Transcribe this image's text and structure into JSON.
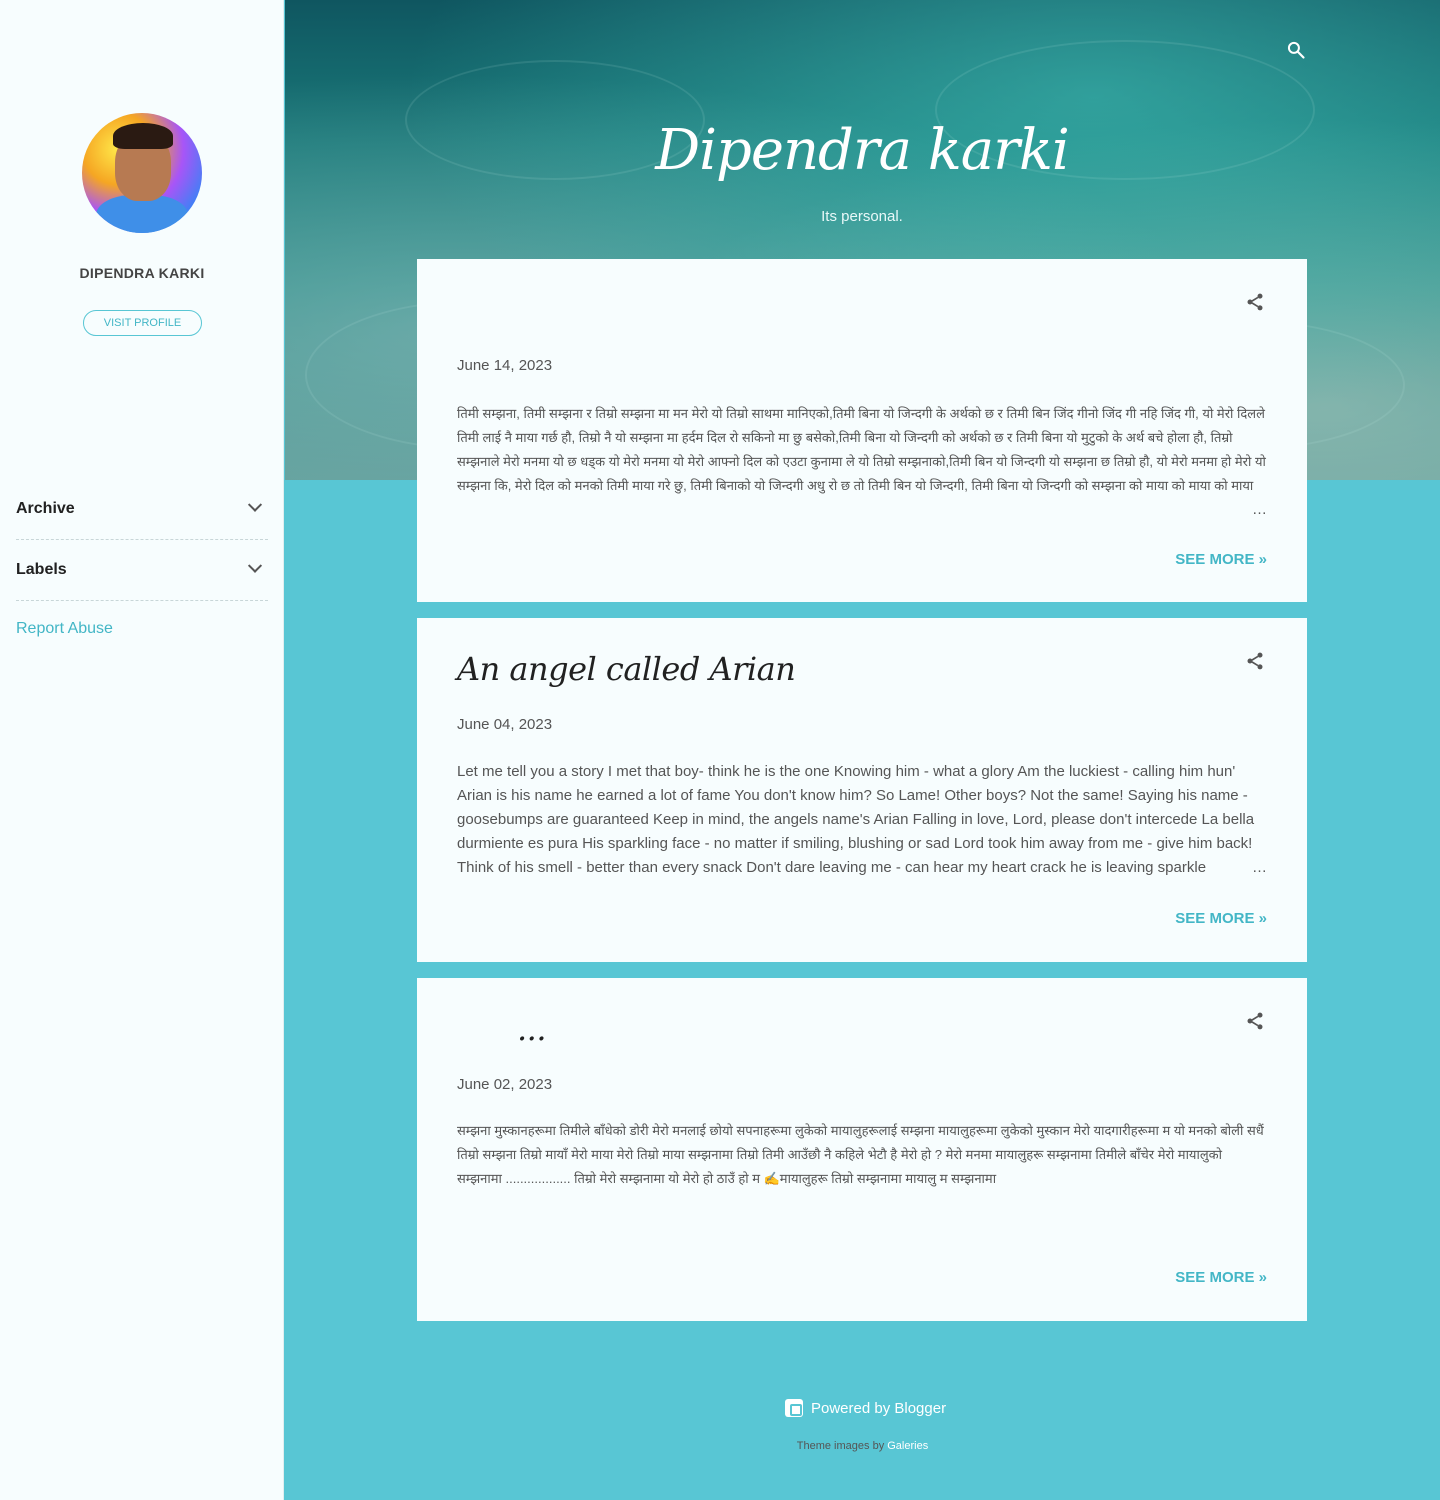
{
  "sidebar": {
    "profile_name": "DIPENDRA KARKI",
    "visit_profile_label": "VISIT PROFILE",
    "sections": [
      {
        "label": "Archive",
        "icon": "chevron-down-icon"
      },
      {
        "label": "Labels",
        "icon": "chevron-down-icon"
      }
    ],
    "report_abuse_label": "Report Abuse"
  },
  "header": {
    "title": "Dipendra karki",
    "description": "Its personal.",
    "search_icon": "search-icon"
  },
  "posts": [
    {
      "title": "",
      "date": "June 14, 2023",
      "snippet": "तिमी सम्झना, तिमी सम्झना र तिम्रो सम्झना मा मन मेरो यो तिम्रो साथमा मानिएको,तिमी बिना यो जिन्दगी के अर्थको छ र  तिमी बिन जिंद गीनो जिंद गी नहि जिंद गी, यो मेरो दिलले तिमी लाई नै माया गर्छ हौ, तिम्रो नै यो सम्झना मा हर्दम दिल रो सकिनो मा छु बसेको,तिमी बिना यो जिन्दगी को अर्थको छ र  तिमी बिना यो मुटुको के अर्थ बचे होला हौ, तिम्रो सम्झनाले मेरो मनमा यो छ धड्क यो मेरो मनमा यो मेरो आफ्नो दिल को एउटा कुनामा ले यो तिम्रो सम्झनाको,तिमी बिन यो जिन्दगी यो सम्झना छ तिम्रो हौ, यो मेरो मनमा हो मेरो यो सम्झना कि, मेरो दिल को मनको तिमी माया गरे छु, तिमी बिनाको यो जिन्दगी अधु रो छ तो तिमी बिन यो जिन्दगी, तिमी बिना यो जिन्दगी को सम्झना को माया को माया को माया",
      "see_more_label": "SEE MORE »",
      "share_icon": "share-icon"
    },
    {
      "title": "An angel called Arian",
      "date": "June 04, 2023",
      "snippet": "Let me tell you a story I met that boy- think he is the one Knowing him - what a glory  Am the luckiest - calling him hun' Arian is his name he earned a lot of fame  You don't know him? So Lame! Other boys? Not the same! Saying his name - goosebumps are guaranteed Keep in mind, the angels name's Arian Falling in love, Lord, please don't intercede La bella durmiente es pura His sparkling face - no matter if smiling, blushing or sad Lord took him away from me - give him back! Think of his smell - better than every snack Don't dare leaving me - can hear my heart crack he is leaving sparkle",
      "see_more_label": "SEE MORE »",
      "share_icon": "share-icon"
    },
    {
      "title": "...",
      "date": "June 02, 2023",
      "snippet": " सम्झना  मुस्कानहरूमा तिमीले बाँधेको डोरी मेरो मनलाई छोयो सपनाहरूमा लुकेको मायालुहरूलाई सम्झना मायालुहरूमा लुकेको मुस्कान मेरो यादगारीहरूमा म   यो मनको बोली सधैं तिम्रो सम्झना तिम्रो मायाँ मेरो माया मेरो तिम्रो माया सम्झनामा तिम्रो तिमी आउँछौ नै कहिले भेटौ है मेरो हो ?   मेरो मनमा मायालुहरू सम्झनामा तिमीले बाँचेर मेरो मायालुको सम्झनामा .................. तिम्रो मेरो सम्झनामा यो मेरो हो ठाउँ हो म                                        ✍️मायालुहरू तिम्रो सम्झनामा                                मायालु म सम्झनामा",
      "see_more_label": "SEE MORE »",
      "share_icon": "share-icon"
    }
  ],
  "footer": {
    "powered_by": "Powered by Blogger",
    "theme_credit_prefix": "Theme images by ",
    "theme_credit_link": "Galeries"
  },
  "colors": {
    "accent": "#58c6d4",
    "link": "#43b6c6",
    "card_background": "#f7fdfe"
  }
}
